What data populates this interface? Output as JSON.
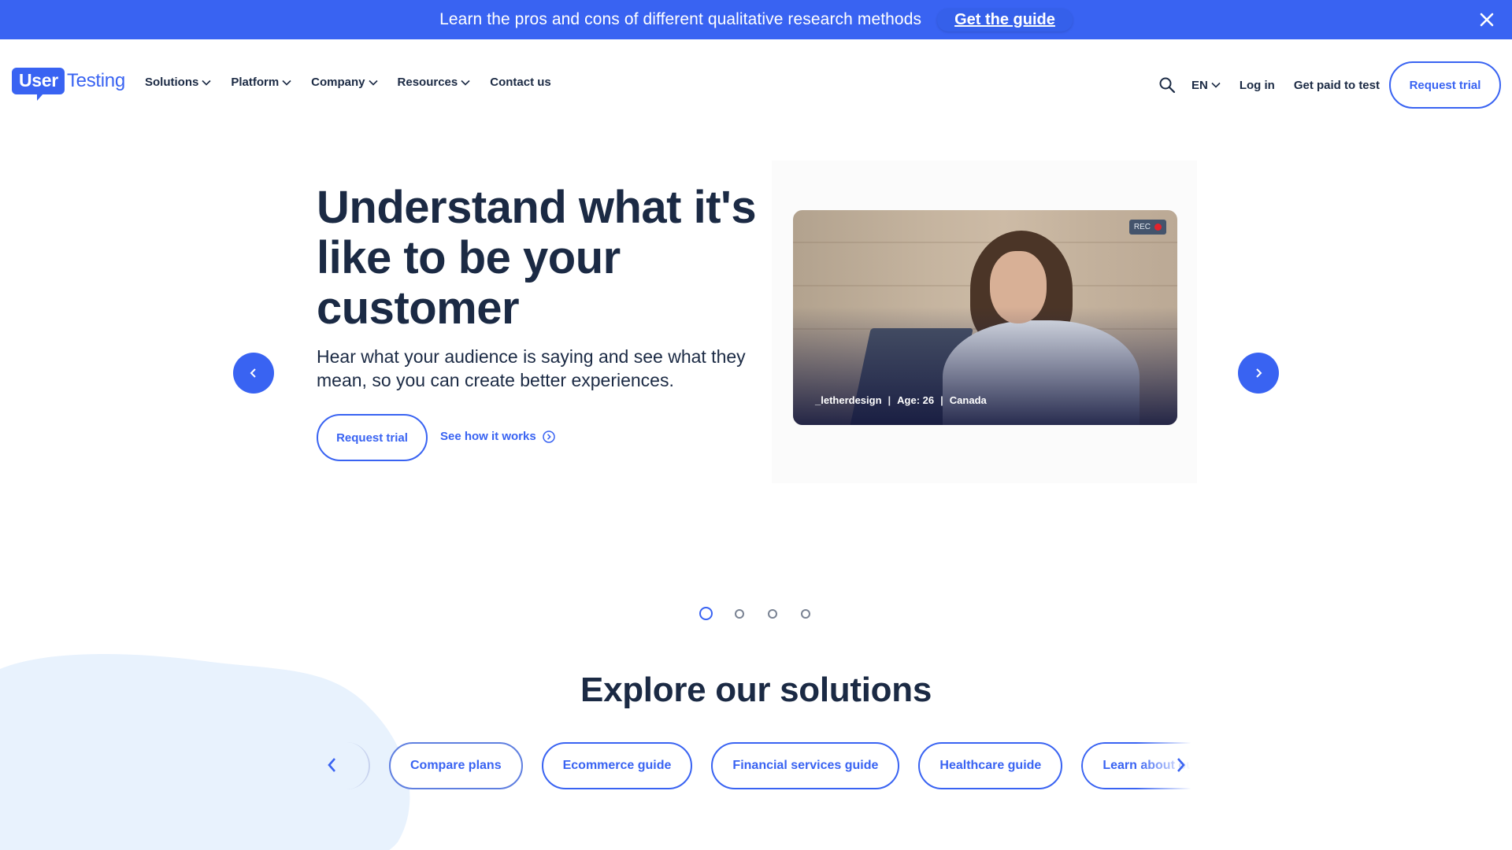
{
  "announcement": {
    "text": "Learn the pros and cons of different qualitative research methods",
    "link_label": "Get the guide"
  },
  "header": {
    "logo": {
      "user": "User",
      "testing": "Testing"
    },
    "nav": [
      {
        "label": "Solutions",
        "has_menu": true
      },
      {
        "label": "Platform",
        "has_menu": true
      },
      {
        "label": "Company",
        "has_menu": true
      },
      {
        "label": "Resources",
        "has_menu": true
      },
      {
        "label": "Contact us",
        "has_menu": false
      }
    ],
    "language": "EN",
    "login_label": "Log in",
    "get_paid_label": "Get paid to test",
    "request_trial_label": "Request trial"
  },
  "hero": {
    "title": "Understand what it's like to be your customer",
    "subtitle": "Hear what your audience is saying and see what they mean, so you can create better experiences.",
    "primary_cta": "Request trial",
    "secondary_cta": "See how it works",
    "video": {
      "rec_label": "REC",
      "username": "_letherdesign",
      "age": "Age: 26",
      "country": "Canada",
      "separator": "|"
    },
    "carousel": {
      "slide_count": 4,
      "active_index": 0
    }
  },
  "explore": {
    "title": "Explore our solutions",
    "pills": [
      "Compare plans",
      "Ecommerce guide",
      "Financial services guide",
      "Healthcare guide",
      "Learn about our"
    ]
  },
  "colors": {
    "brand_blue": "#3963f2",
    "heading_navy": "#1b2a44",
    "blob_light_blue": "#e8f2fd"
  }
}
